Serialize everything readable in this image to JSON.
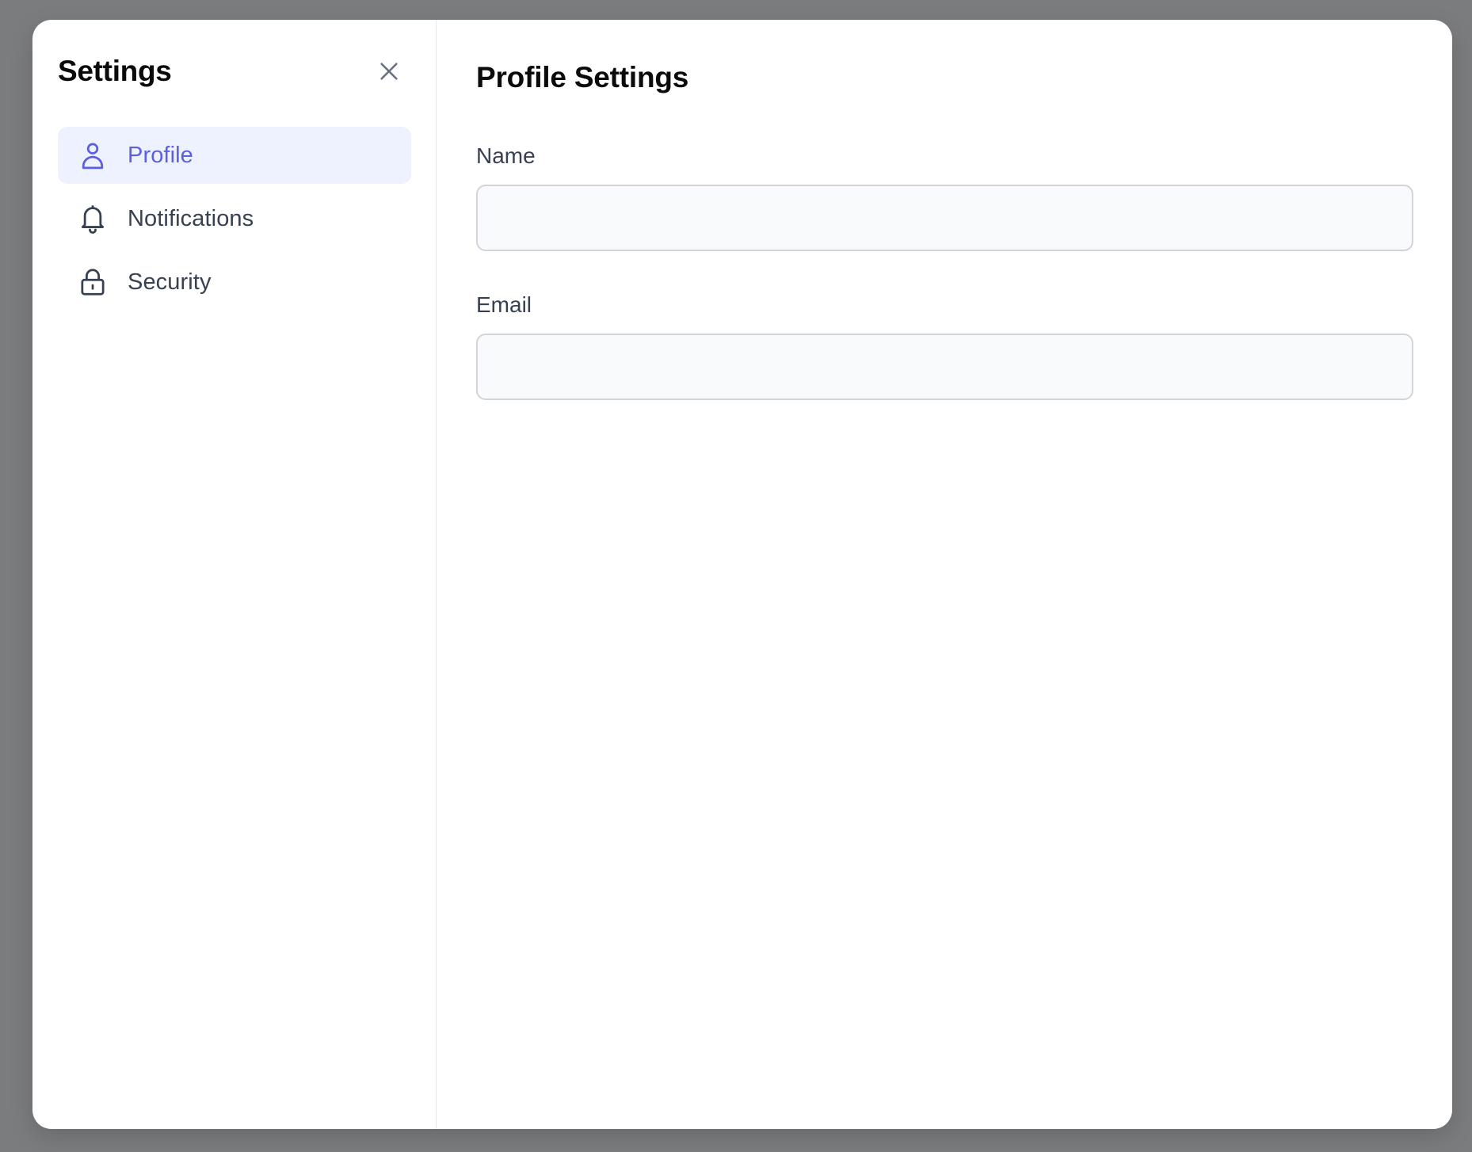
{
  "sidebar": {
    "title": "Settings",
    "close_icon": "close-icon",
    "items": [
      {
        "label": "Profile",
        "icon": "user-icon",
        "active": true
      },
      {
        "label": "Notifications",
        "icon": "bell-icon",
        "active": false
      },
      {
        "label": "Security",
        "icon": "lock-icon",
        "active": false
      }
    ]
  },
  "main": {
    "title": "Profile Settings",
    "fields": [
      {
        "label": "Name",
        "value": "",
        "placeholder": ""
      },
      {
        "label": "Email",
        "value": "",
        "placeholder": ""
      }
    ]
  },
  "colors": {
    "accent": "#5b5fe0",
    "active_bg": "#eef2fe",
    "overlay": "#7b7c7e"
  }
}
